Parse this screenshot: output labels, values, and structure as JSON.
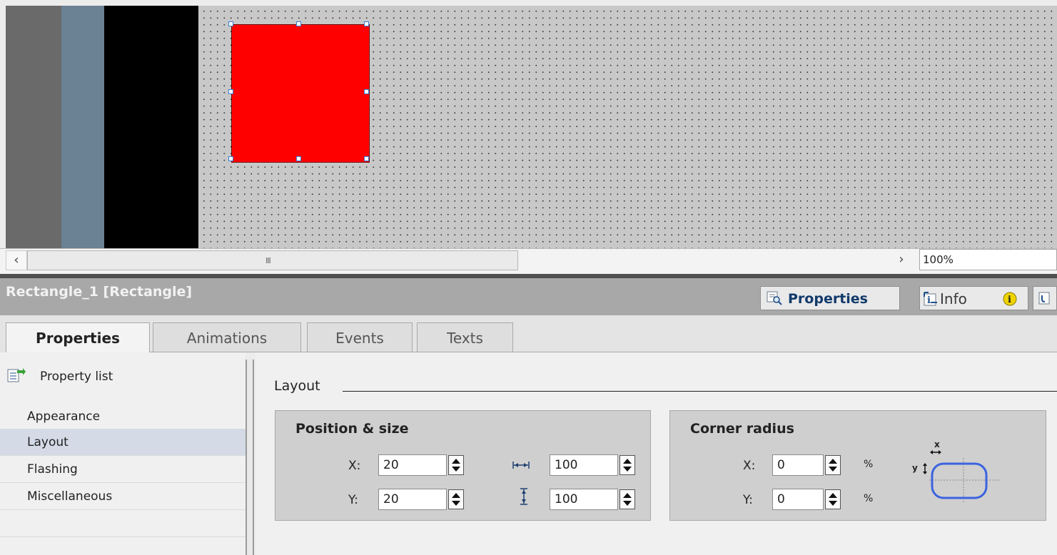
{
  "canvas": {
    "zoom": "100%",
    "shape_color": "#ff0000",
    "strip_colors": [
      "#6a6a6a",
      "#6b8194",
      "#000000"
    ],
    "scroll_left": "‹",
    "scroll_right": "›",
    "scroll_grip": "III"
  },
  "inspector": {
    "title": "Rectangle_1 [Rectangle]",
    "properties_button": "Properties",
    "info_button": "Info"
  },
  "tabs": [
    {
      "label": "Properties",
      "active": true
    },
    {
      "label": "Animations",
      "active": false
    },
    {
      "label": "Events",
      "active": false
    },
    {
      "label": "Texts",
      "active": false
    }
  ],
  "nav": {
    "property_list": "Property list",
    "items": [
      {
        "label": "Appearance",
        "selected": false
      },
      {
        "label": "Layout",
        "selected": true
      },
      {
        "label": "Flashing",
        "selected": false
      },
      {
        "label": "Miscellaneous",
        "selected": false
      }
    ]
  },
  "layout": {
    "heading": "Layout",
    "position_size": {
      "title": "Position & size",
      "x_label": "X:",
      "x_value": "20",
      "y_label": "Y:",
      "y_value": "20",
      "width_value": "100",
      "height_value": "100"
    },
    "corner_radius": {
      "title": "Corner radius",
      "x_label": "X:",
      "x_value": "0",
      "y_label": "Y:",
      "y_value": "0",
      "unit": "%",
      "diagram_x": "x",
      "diagram_y": "y"
    }
  }
}
